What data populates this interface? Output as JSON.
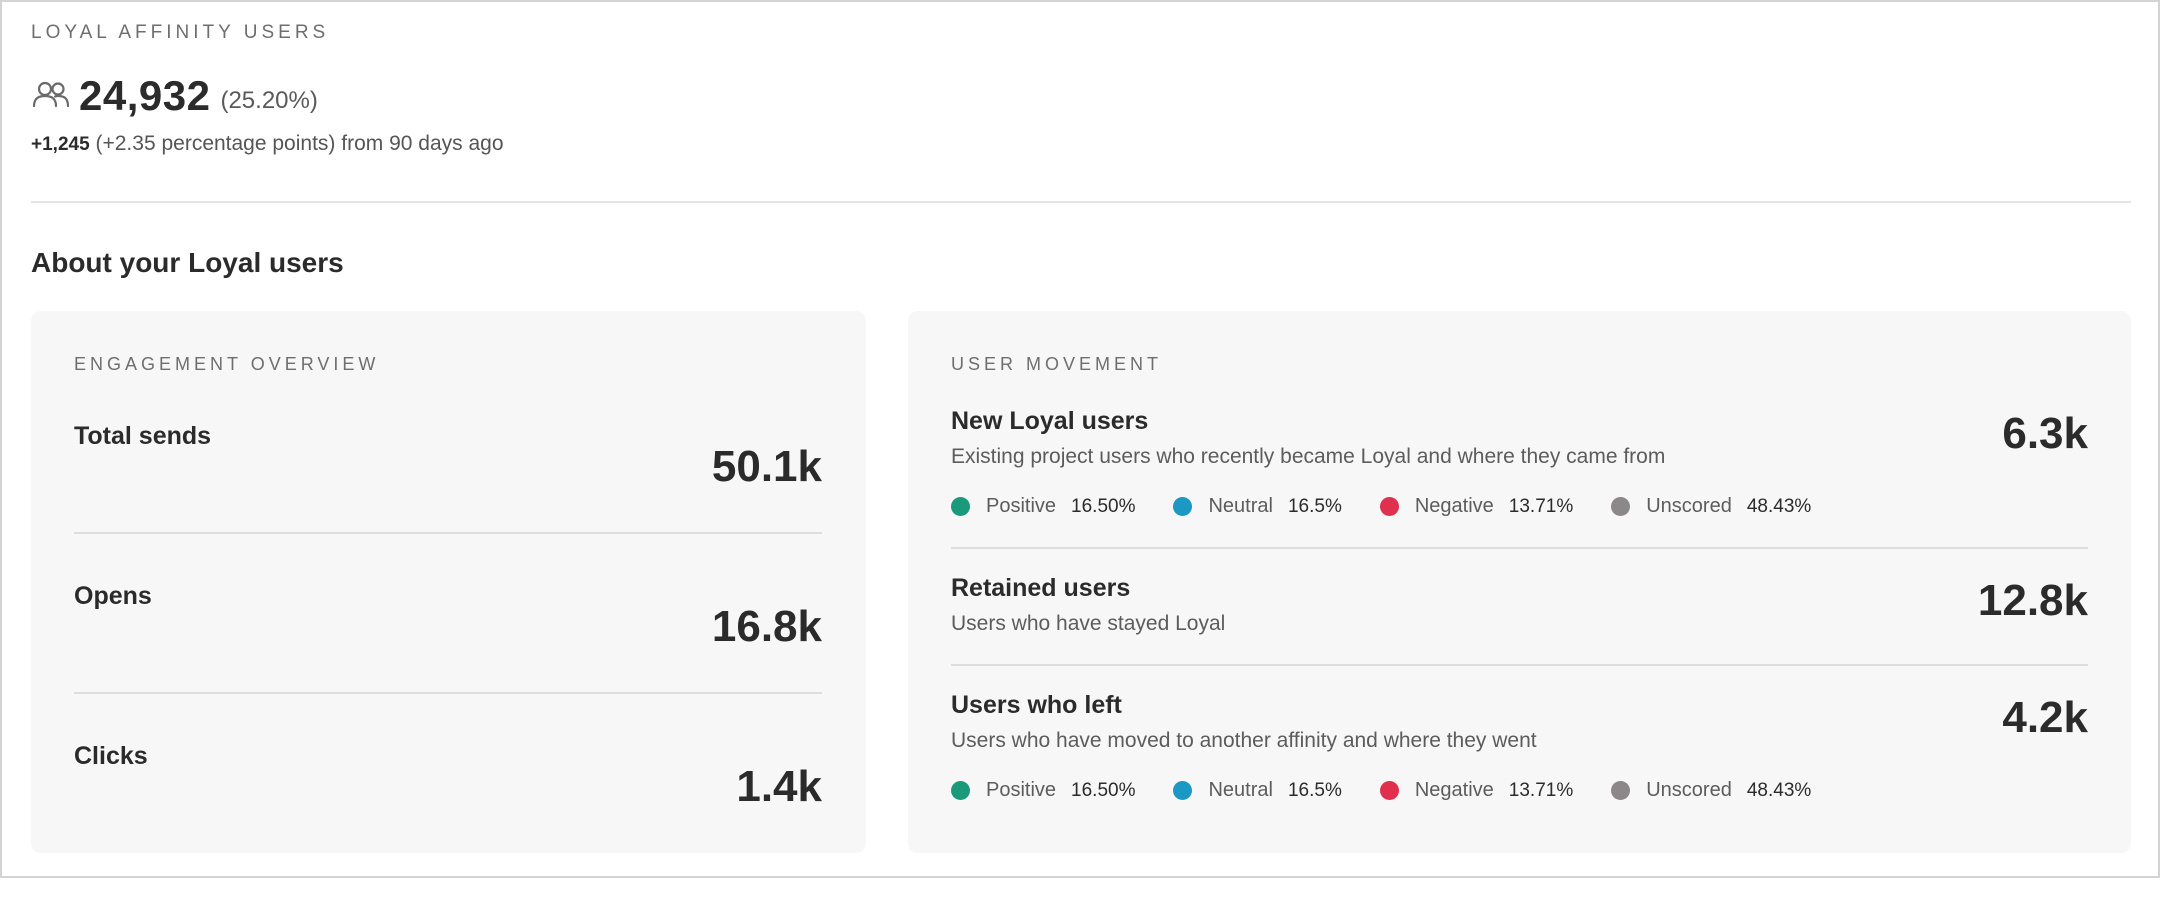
{
  "header": {
    "section_label": "LOYAL AFFINITY USERS",
    "total_users": "24,932",
    "total_pct": "(25.20%)",
    "delta_value": "+1,245",
    "delta_text": "(+2.35 percentage points) from 90 days ago",
    "icon": "users-icon"
  },
  "about": {
    "title": "About your Loyal users"
  },
  "engagement": {
    "label": "ENGAGEMENT OVERVIEW",
    "rows": [
      {
        "label": "Total sends",
        "value": "50.1k"
      },
      {
        "label": "Opens",
        "value": "16.8k"
      },
      {
        "label": "Clicks",
        "value": "1.4k"
      }
    ]
  },
  "movement": {
    "label": "USER MOVEMENT",
    "new_loyal": {
      "title": "New Loyal users",
      "desc": "Existing project users who recently became Loyal and where they came from",
      "value": "6.3k",
      "legend": [
        {
          "name": "Positive",
          "value": "16.50%",
          "color": "#1a9a7b"
        },
        {
          "name": "Neutral",
          "value": "16.5%",
          "color": "#1b98c4"
        },
        {
          "name": "Negative",
          "value": "13.71%",
          "color": "#e0304e"
        },
        {
          "name": "Unscored",
          "value": "48.43%",
          "color": "#8c8788"
        }
      ]
    },
    "retained": {
      "title": "Retained users",
      "desc": "Users who have stayed Loyal",
      "value": "12.8k"
    },
    "left": {
      "title": "Users who left",
      "desc": "Users who have moved to another affinity and where they went",
      "value": "4.2k",
      "legend": [
        {
          "name": "Positive",
          "value": "16.50%",
          "color": "#1a9a7b"
        },
        {
          "name": "Neutral",
          "value": "16.5%",
          "color": "#1b98c4"
        },
        {
          "name": "Negative",
          "value": "13.71%",
          "color": "#e0304e"
        },
        {
          "name": "Unscored",
          "value": "48.43%",
          "color": "#8c8788"
        }
      ]
    }
  }
}
